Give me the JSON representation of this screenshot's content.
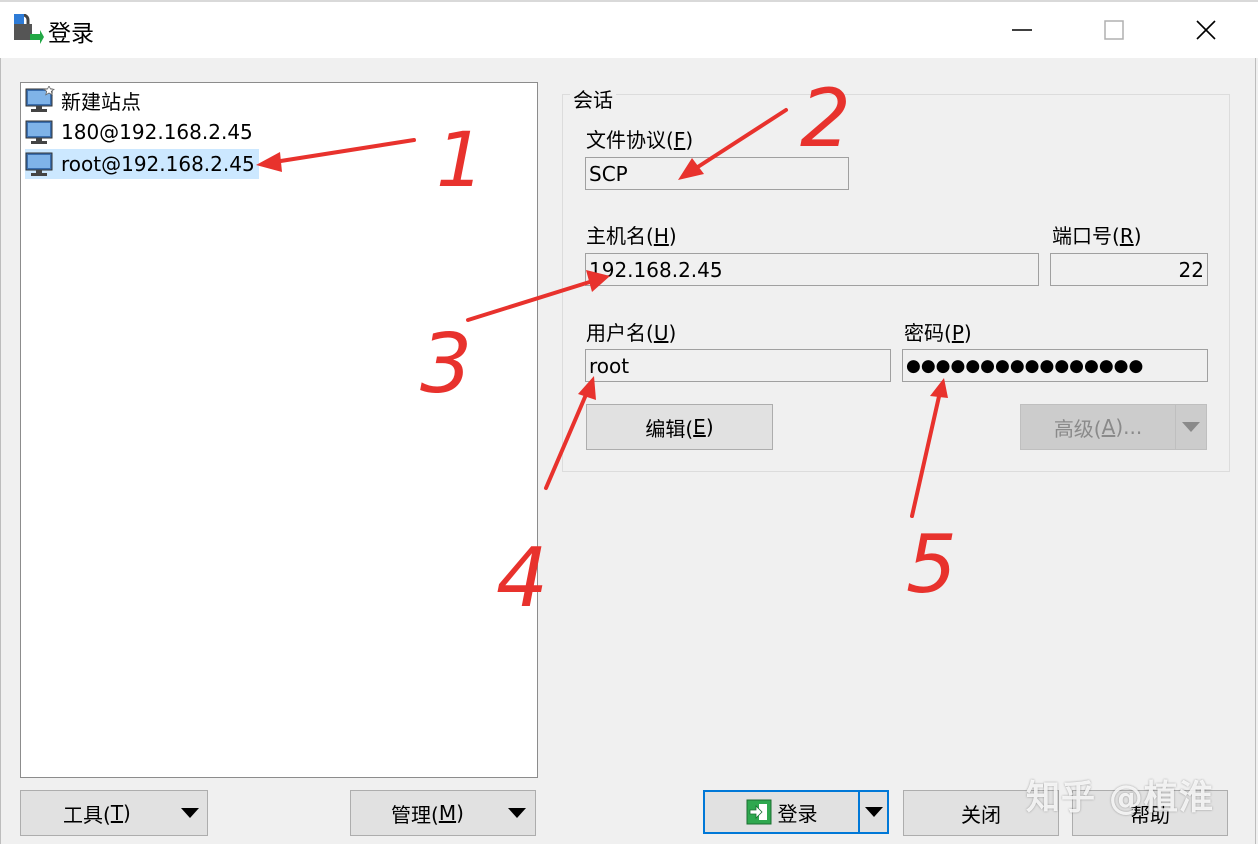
{
  "window": {
    "title": "登录",
    "minimize": "—",
    "close": "✕"
  },
  "site_tree": {
    "items": [
      {
        "label": "新建站点",
        "icon": "new-site-monitor-icon"
      },
      {
        "label": "180@192.168.2.45",
        "icon": "monitor-icon"
      },
      {
        "label": "root@192.168.2.45",
        "icon": "monitor-icon",
        "selected": true
      }
    ]
  },
  "session": {
    "legend": "会话",
    "protocol_label": "文件协议(",
    "protocol_key": "F",
    "protocol_close": ")",
    "protocol_value": "SCP",
    "host_label": "主机名(",
    "host_key": "H",
    "host_close": ")",
    "host_value": "192.168.2.45",
    "port_label": "端口号(",
    "port_key": "R",
    "port_close": ")",
    "port_value": "22",
    "user_label": "用户名(",
    "user_key": "U",
    "user_close": ")",
    "user_value": "root",
    "password_label": "密码(",
    "password_key": "P",
    "password_close": ")",
    "password_value": "●●●●●●●●●●●●●●●●",
    "edit_label": "编辑(",
    "edit_key": "E",
    "edit_close": ")",
    "advanced_label": "高级(",
    "advanced_key": "A",
    "advanced_close": ")..."
  },
  "bottom": {
    "tools_label": "工具(",
    "tools_key": "T",
    "tools_close": ")",
    "manage_label": "管理(",
    "manage_key": "M",
    "manage_close": ")",
    "login_label": "登录",
    "close_label": "关闭",
    "help_label": "帮助"
  },
  "annotations": {
    "numbers": [
      "1",
      "2",
      "3",
      "4",
      "5"
    ],
    "color": "#e8322d"
  },
  "watermark": "知乎 @植淮"
}
